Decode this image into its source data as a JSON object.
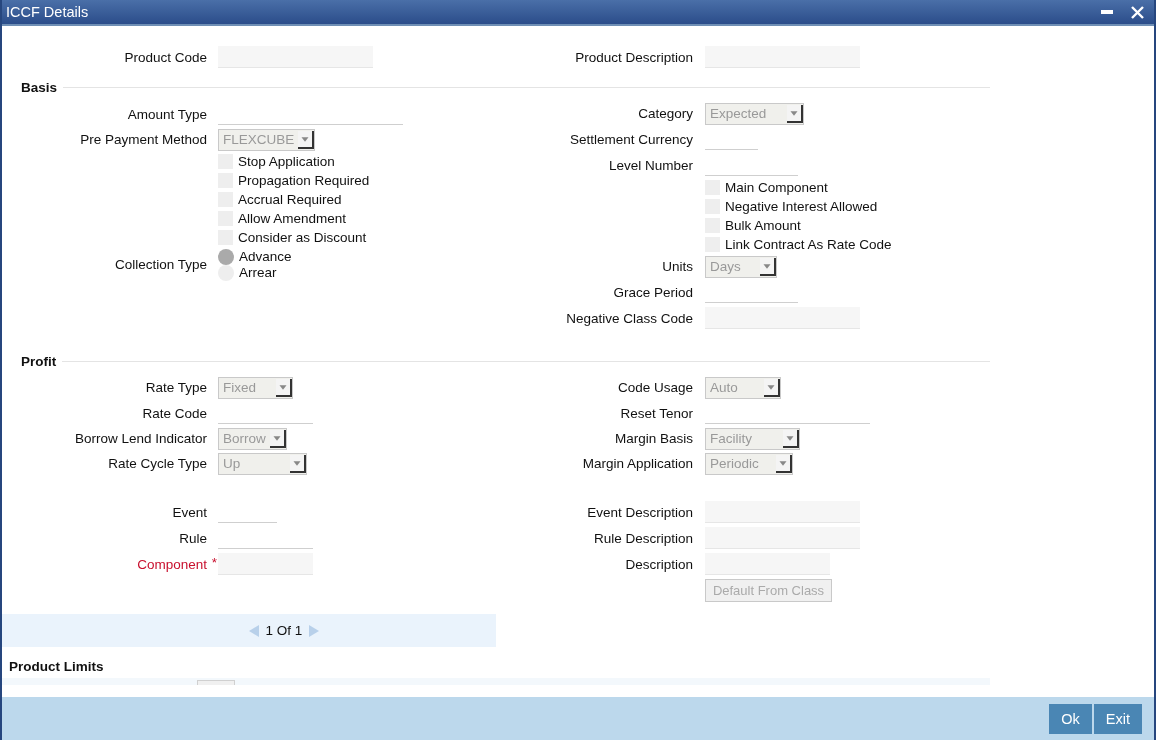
{
  "window": {
    "title": "ICCF Details"
  },
  "header": {
    "left": [
      {
        "kind": "display",
        "label": "Product Code"
      }
    ],
    "right": [
      {
        "kind": "display",
        "label": "Product Description"
      }
    ]
  },
  "sections": [
    {
      "title": "Basis",
      "groups": [
        {
          "left": [
            {
              "kind": "text",
              "label": "Amount Type"
            },
            {
              "kind": "select",
              "label": "Pre Payment Method",
              "value": "FLEXCUBE"
            },
            {
              "kind": "checkbox",
              "label": "Stop Application",
              "checked": false
            },
            {
              "kind": "checkbox",
              "label": "Propagation Required",
              "checked": false
            },
            {
              "kind": "checkbox",
              "label": "Accrual Required",
              "checked": false
            },
            {
              "kind": "checkbox",
              "label": "Allow Amendment",
              "checked": false
            },
            {
              "kind": "checkbox",
              "label": "Consider as Discount",
              "checked": false
            },
            {
              "kind": "radio",
              "label": "Collection Type",
              "options": [
                {
                  "label": "Advance",
                  "selected": true
                },
                {
                  "label": "Arrear",
                  "selected": false
                }
              ]
            }
          ],
          "right": [
            {
              "kind": "select",
              "label": "Category",
              "value": "Expected"
            },
            {
              "kind": "text",
              "label": "Settlement Currency"
            },
            {
              "kind": "text",
              "label": "Level Number"
            },
            {
              "kind": "checkbox",
              "label": "Main Component",
              "checked": false
            },
            {
              "kind": "checkbox",
              "label": "Negative Interest Allowed",
              "checked": false
            },
            {
              "kind": "checkbox",
              "label": "Bulk Amount",
              "checked": false
            },
            {
              "kind": "checkbox",
              "label": "Link Contract As Rate Code",
              "checked": false
            },
            {
              "kind": "select",
              "label": "Units",
              "value": "Days"
            },
            {
              "kind": "text",
              "label": "Grace Period"
            },
            {
              "kind": "display",
              "label": "Negative Class Code"
            }
          ]
        }
      ]
    },
    {
      "title": "Profit",
      "groups": [
        {
          "left": [
            {
              "kind": "select",
              "label": "Rate Type",
              "value": "Fixed"
            },
            {
              "kind": "text",
              "label": "Rate Code"
            },
            {
              "kind": "select",
              "label": "Borrow Lend Indicator",
              "value": "Borrow"
            },
            {
              "kind": "select",
              "label": "Rate Cycle Type",
              "value": "Up"
            }
          ],
          "right": [
            {
              "kind": "select",
              "label": "Code Usage",
              "value": "Auto"
            },
            {
              "kind": "text",
              "label": "Reset Tenor"
            },
            {
              "kind": "select",
              "label": "Margin Basis",
              "value": "Facility"
            },
            {
              "kind": "select",
              "label": "Margin Application",
              "value": "Periodic"
            }
          ]
        },
        {
          "left": [
            {
              "kind": "text",
              "label": "Event"
            },
            {
              "kind": "text",
              "label": "Rule"
            },
            {
              "kind": "display",
              "label": "Component",
              "required": true,
              "required_mark": "*"
            }
          ],
          "right": [
            {
              "kind": "display",
              "label": "Event Description"
            },
            {
              "kind": "display",
              "label": "Rule Description"
            },
            {
              "kind": "display",
              "label": "Description"
            },
            {
              "kind": "button",
              "label": "Default From Class",
              "disabled": true
            }
          ]
        }
      ]
    }
  ],
  "pagination": {
    "text": "1 Of 1"
  },
  "limits": {
    "title": "Product Limits"
  },
  "buttons": [
    {
      "label": "Ok"
    },
    {
      "label": "Exit"
    }
  ]
}
